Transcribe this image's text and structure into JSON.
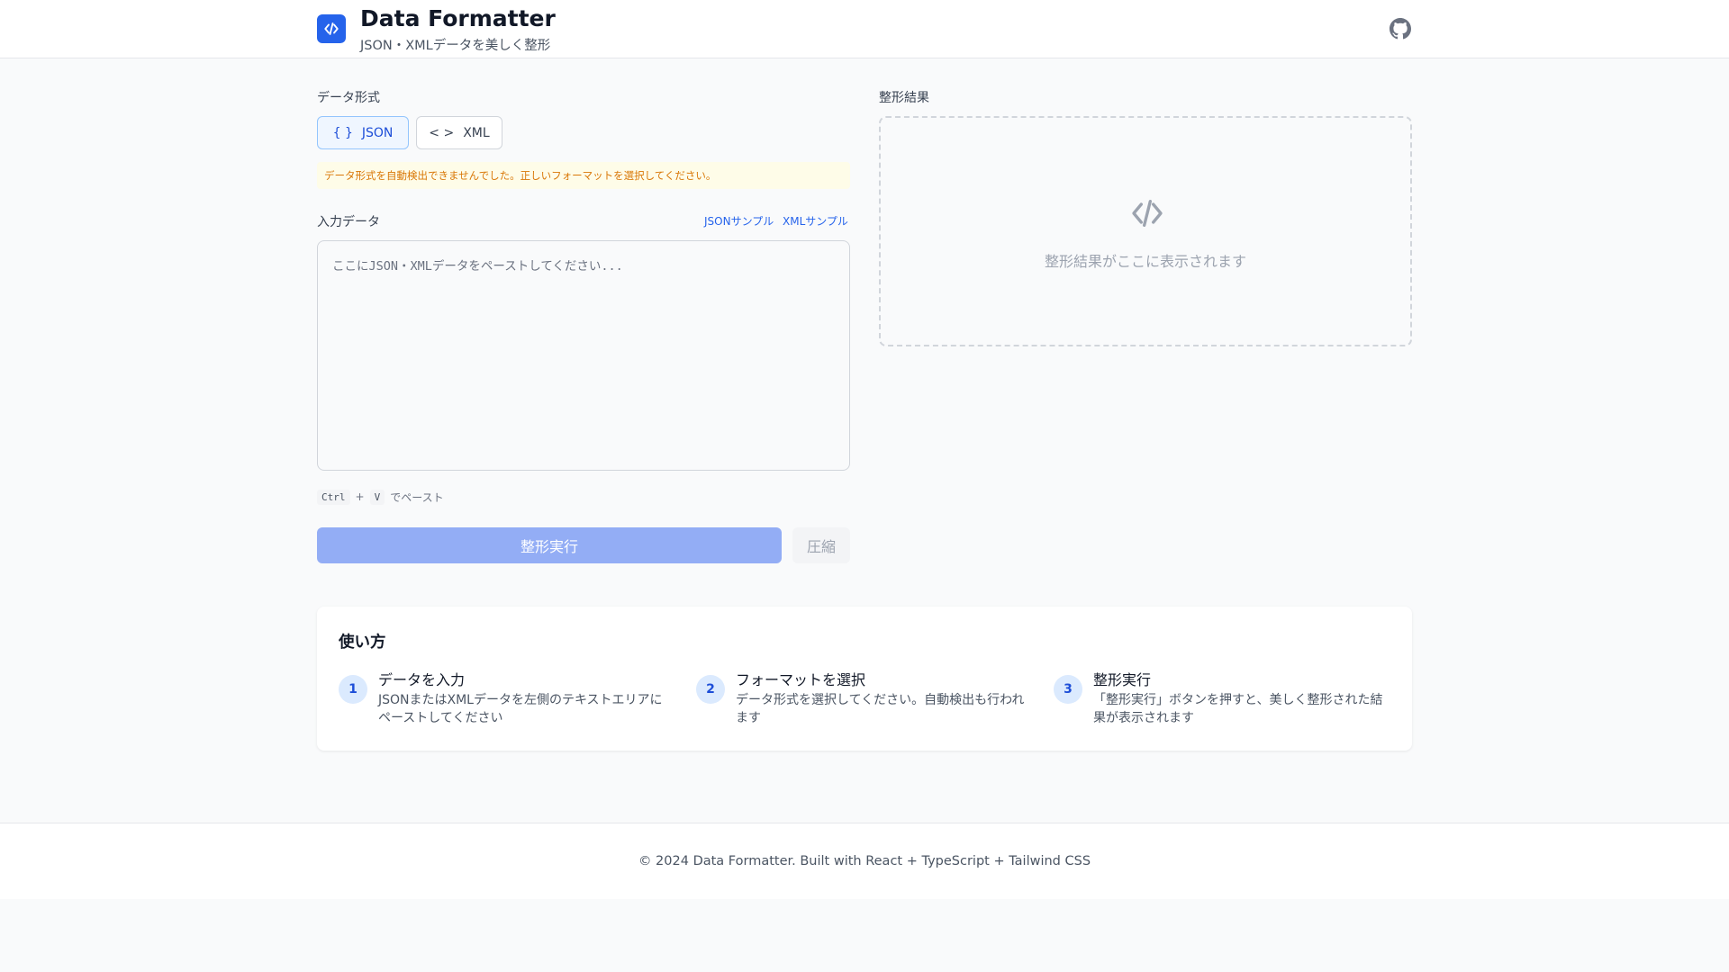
{
  "header": {
    "title": "Data Formatter",
    "subtitle": "JSON・XMLデータを美しく整形",
    "logo_icon": "code-icon",
    "github_icon": "github-icon"
  },
  "input_panel": {
    "format_label": "データ形式",
    "formats": [
      {
        "icon_text": "{ }",
        "label": "JSON",
        "selected": true
      },
      {
        "icon_text": "< >",
        "label": "XML",
        "selected": false
      }
    ],
    "warning": "データ形式を自動検出できませんでした。正しいフォーマットを選択してください。",
    "input_label": "入力データ",
    "json_sample_link": "JSONサンプル",
    "xml_sample_link": "XMLサンプル",
    "input_value": "",
    "input_placeholder": "ここにJSON・XMLデータをペーストしてください...",
    "hint": {
      "key1": "Ctrl",
      "plus": "+",
      "key2": "V",
      "text": "でペースト"
    },
    "format_button": "整形実行",
    "minify_button": "圧縮"
  },
  "result_panel": {
    "label": "整形結果",
    "placeholder_icon": "code-icon",
    "placeholder_text": "整形結果がここに表示されます"
  },
  "howto": {
    "title": "使い方",
    "steps": [
      {
        "number": "1",
        "title": "データを入力",
        "description": "JSONまたはXMLデータを左側のテキストエリアにペーストしてください"
      },
      {
        "number": "2",
        "title": "フォーマットを選択",
        "description": "データ形式を選択してください。自動検出も行われます"
      },
      {
        "number": "3",
        "title": "整形実行",
        "description": "「整形実行」ボタンを押すと、美しく整形された結果が表示されます"
      }
    ]
  },
  "footer": {
    "text": "© 2024 Data Formatter. Built with React + TypeScript + Tailwind CSS"
  },
  "colors": {
    "primary": "#2563eb",
    "warning_text": "#d97706",
    "warning_bg": "#fefce8",
    "disabled_primary": "#93adf5"
  }
}
